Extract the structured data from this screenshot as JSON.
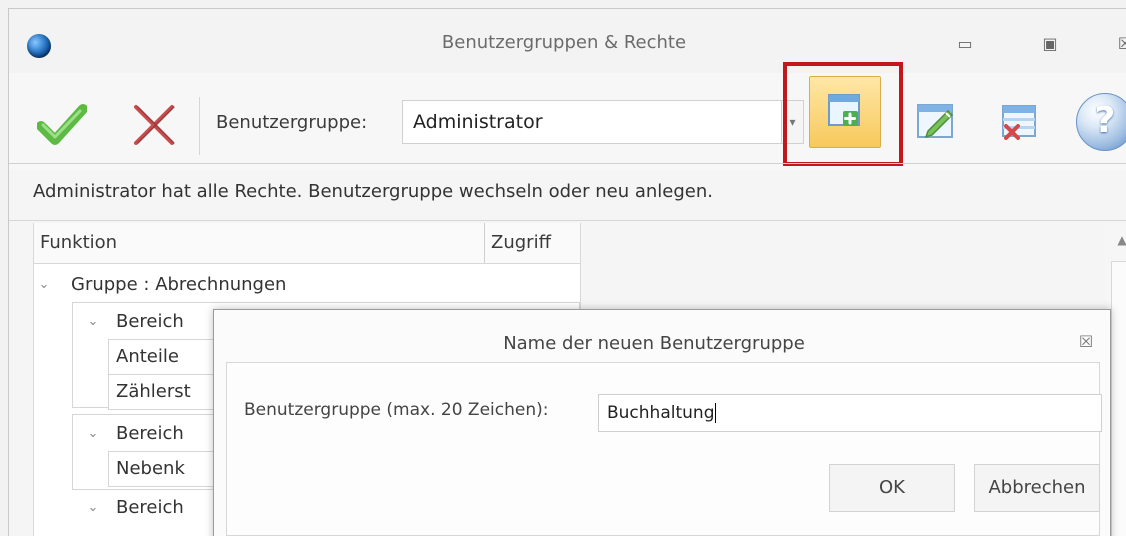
{
  "window": {
    "title": "Benutzergruppen & Rechte",
    "minimize_glyph": "▭",
    "maximize_glyph": "▣",
    "close_glyph": "☒"
  },
  "toolbar": {
    "group_label": "Benutzergruppe:",
    "group_value": "Administrator",
    "dropdown_glyph": "▾",
    "help_glyph": "?"
  },
  "info": {
    "message": "Administrator hat alle Rechte. Benutzergruppe wechseln oder neu anlegen."
  },
  "tree": {
    "columns": [
      "Funktion",
      "Zugriff"
    ],
    "rows": [
      {
        "label": "Gruppe : Abrechnungen",
        "chevron": "⌄"
      },
      {
        "label": "Bereich",
        "chevron": "⌄"
      },
      {
        "label": "Anteile",
        "chevron": ""
      },
      {
        "label": "Zählerst",
        "chevron": ""
      },
      {
        "label": "Bereich",
        "chevron": "⌄"
      },
      {
        "label": "Nebenk",
        "chevron": ""
      },
      {
        "label": "Bereich",
        "chevron": "⌄"
      }
    ]
  },
  "dialog": {
    "title": "Name der neuen Benutzergruppe",
    "label": "Benutzergruppe (max. 20 Zeichen):",
    "value": "Buchhaltung",
    "ok_label": "OK",
    "cancel_label": "Abbrechen",
    "close_glyph": "☒"
  },
  "icons": {
    "app": "globe-icon",
    "confirm": "checkmark-icon",
    "cancel": "x-icon",
    "new_group": "new-group-icon",
    "edit_group": "edit-group-icon",
    "delete_group": "delete-group-icon",
    "help": "help-icon"
  },
  "colors": {
    "highlight": "#c2181d",
    "new_button": "#f7c95c",
    "check_green": "#5dbb45",
    "cancel_red": "#c94b4b"
  }
}
